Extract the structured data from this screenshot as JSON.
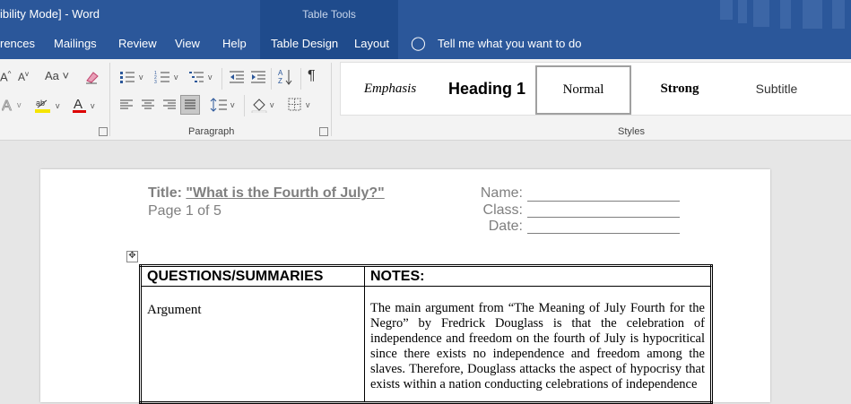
{
  "window": {
    "title": "ibility Mode]  -  Word"
  },
  "table_tools": {
    "label": "Table Tools"
  },
  "tabs": [
    {
      "label": "rences"
    },
    {
      "label": "Mailings"
    },
    {
      "label": "Review"
    },
    {
      "label": "View"
    },
    {
      "label": "Help"
    },
    {
      "label": "Table Design"
    },
    {
      "label": "Layout"
    }
  ],
  "tell_me": {
    "label": "Tell me what you want to do"
  },
  "ribbon": {
    "font_size_glyphs": {
      "grow": "A",
      "shrink": "A",
      "change_case": "Aa"
    },
    "paragraph_label": "Paragraph",
    "styles_label": "Styles",
    "styles": [
      {
        "name": "Emphasis"
      },
      {
        "name": "Heading 1"
      },
      {
        "name": "Normal"
      },
      {
        "name": "Strong"
      },
      {
        "name": "Subtitle"
      }
    ]
  },
  "document": {
    "title_prefix": "Title: ",
    "title_quote": "\"What is the Fourth of July?\"",
    "page_info": "Page 1 of 5",
    "fields": [
      "Name:",
      "Class:",
      "Date:"
    ],
    "table": {
      "headers": [
        "QUESTIONS/SUMMARIES",
        "NOTES:"
      ],
      "rows": [
        {
          "question": "Argument",
          "notes": "The main argument from “The Meaning of July Fourth for the Negro” by Fredrick Douglass is that the celebration of independence and freedom on the fourth of July is hypocritical since there exists no independence and freedom among the slaves. Therefore, Douglass attacks the aspect of hypocrisy that exists within a nation conducting celebrations of independence"
        }
      ]
    }
  }
}
